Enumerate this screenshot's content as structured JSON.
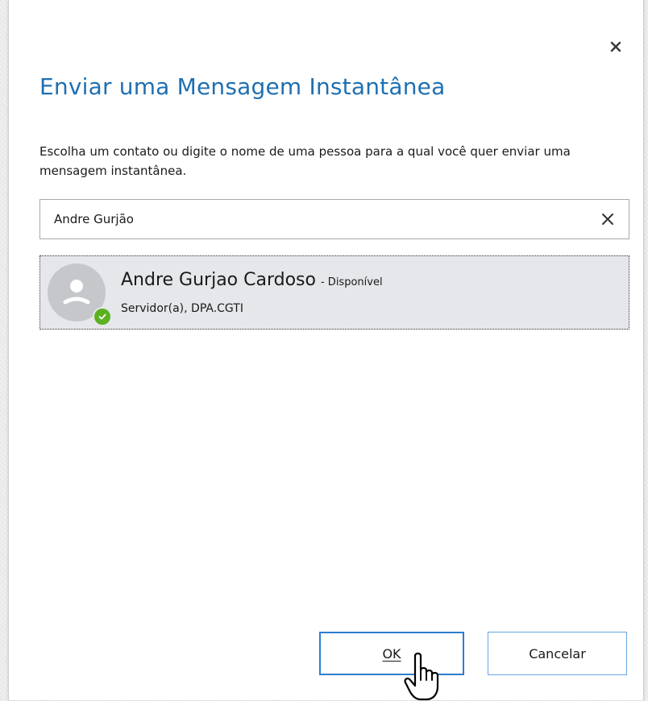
{
  "dialog": {
    "title": "Enviar uma Mensagem Instantânea",
    "instructions": "Escolha um contato ou digite o nome de uma pessoa para a qual você quer enviar uma mensagem instantânea.",
    "close_icon": "close-icon"
  },
  "search": {
    "value": "Andre Gurjão",
    "clear_icon": "clear-icon"
  },
  "results": [
    {
      "name": "Andre Gurjao Cardoso",
      "status": "- Disponível",
      "title": "Servidor(a), DPA.CGTI",
      "presence": "available",
      "presence_color": "#5bb11f"
    }
  ],
  "buttons": {
    "ok_label": "OK",
    "cancel_label": "Cancelar"
  },
  "colors": {
    "accent": "#1f6fb2",
    "button_border": "#2e7dd0",
    "selection_bg": "#e5e7ea"
  }
}
